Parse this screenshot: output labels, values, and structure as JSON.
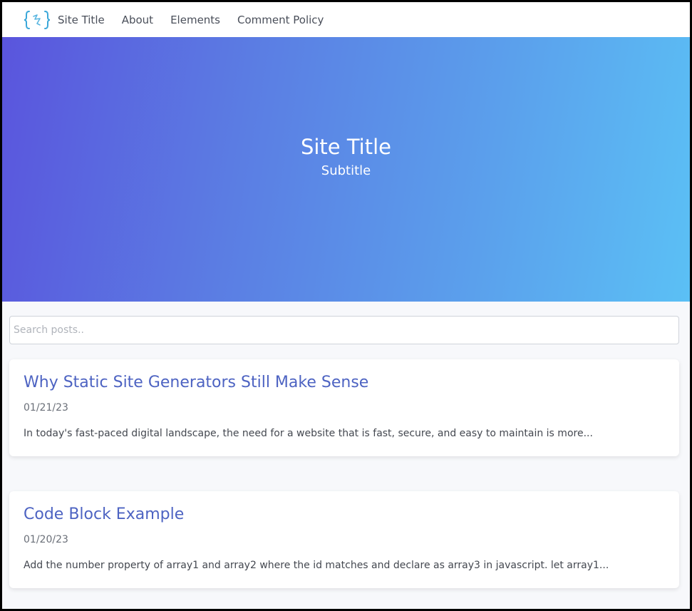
{
  "nav": {
    "logo_icon": "curly-braces-logo-icon",
    "site_title": "Site Title",
    "links": [
      "About",
      "Elements",
      "Comment Policy"
    ]
  },
  "hero": {
    "title": "Site Title",
    "subtitle": "Subtitle"
  },
  "search": {
    "placeholder": "Search posts.."
  },
  "posts": [
    {
      "title": "Why Static Site Generators Still Make Sense",
      "date": "01/21/23",
      "excerpt": "In today's fast-paced digital landscape, the need for a website that is fast, secure, and easy to maintain is more..."
    },
    {
      "title": "Code Block Example",
      "date": "01/20/23",
      "excerpt": "Add the number property of array1 and array2 where the id matches and declare as array3 in javascript. let array1..."
    }
  ],
  "colors": {
    "accent": "#4d63c2",
    "hero_gradient_start": "#5a55dd",
    "hero_gradient_end": "#5bc0f5",
    "logo": "#3aa7d9"
  }
}
